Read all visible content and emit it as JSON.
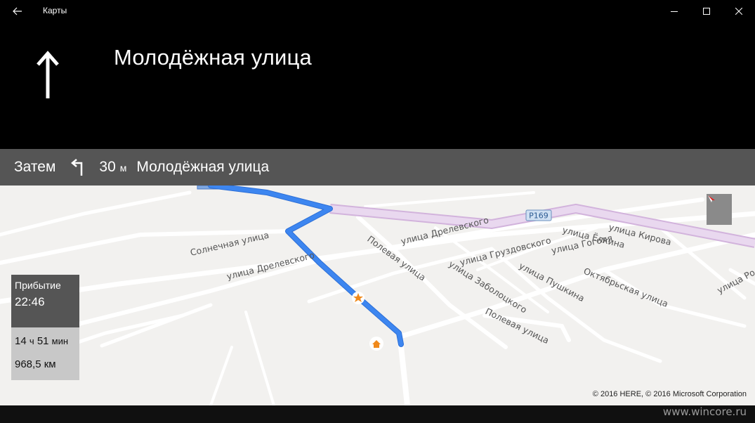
{
  "window": {
    "title": "Карты",
    "icons": {
      "back": "back-arrow-icon",
      "minimize": "minimize-icon",
      "maximize": "maximize-icon",
      "close": "close-icon"
    }
  },
  "nav": {
    "maneuver_icon": "arrow-straight-icon",
    "current_street": "Молодёжная улица"
  },
  "next": {
    "label": "Затем",
    "turn_icon": "turn-left-icon",
    "distance": "30",
    "unit": "м",
    "street": "Молодёжная улица"
  },
  "map": {
    "route_color": "#3d86f0",
    "highway_color": "#e6d4ec",
    "road_badge": "P169",
    "streets": {
      "s1": "Солнечная улица",
      "s2": "улица Дрелевского",
      "s3": "улица Дрелевского",
      "s4": "Полевая улица",
      "s5": "улица Груздовского",
      "s6": "улица Гоголя",
      "s7": "улица Ёлкина",
      "s8": "улица Кирова",
      "s9": "улица Пушкина",
      "s10": "улица Заболоцкого",
      "s11": "Октябрьская улица",
      "s12": "Полевая улица",
      "s13": "улица Ро"
    },
    "copyright": "© 2016 HERE, © 2016 Microsoft Corporation"
  },
  "trip": {
    "arrival_label": "Прибытие",
    "arrival_time": "22:46",
    "hours": "14",
    "hours_unit": "ч",
    "minutes": "51",
    "minutes_unit": "мин",
    "distance": "968,5 км"
  },
  "watermark": "www.wincore.ru"
}
